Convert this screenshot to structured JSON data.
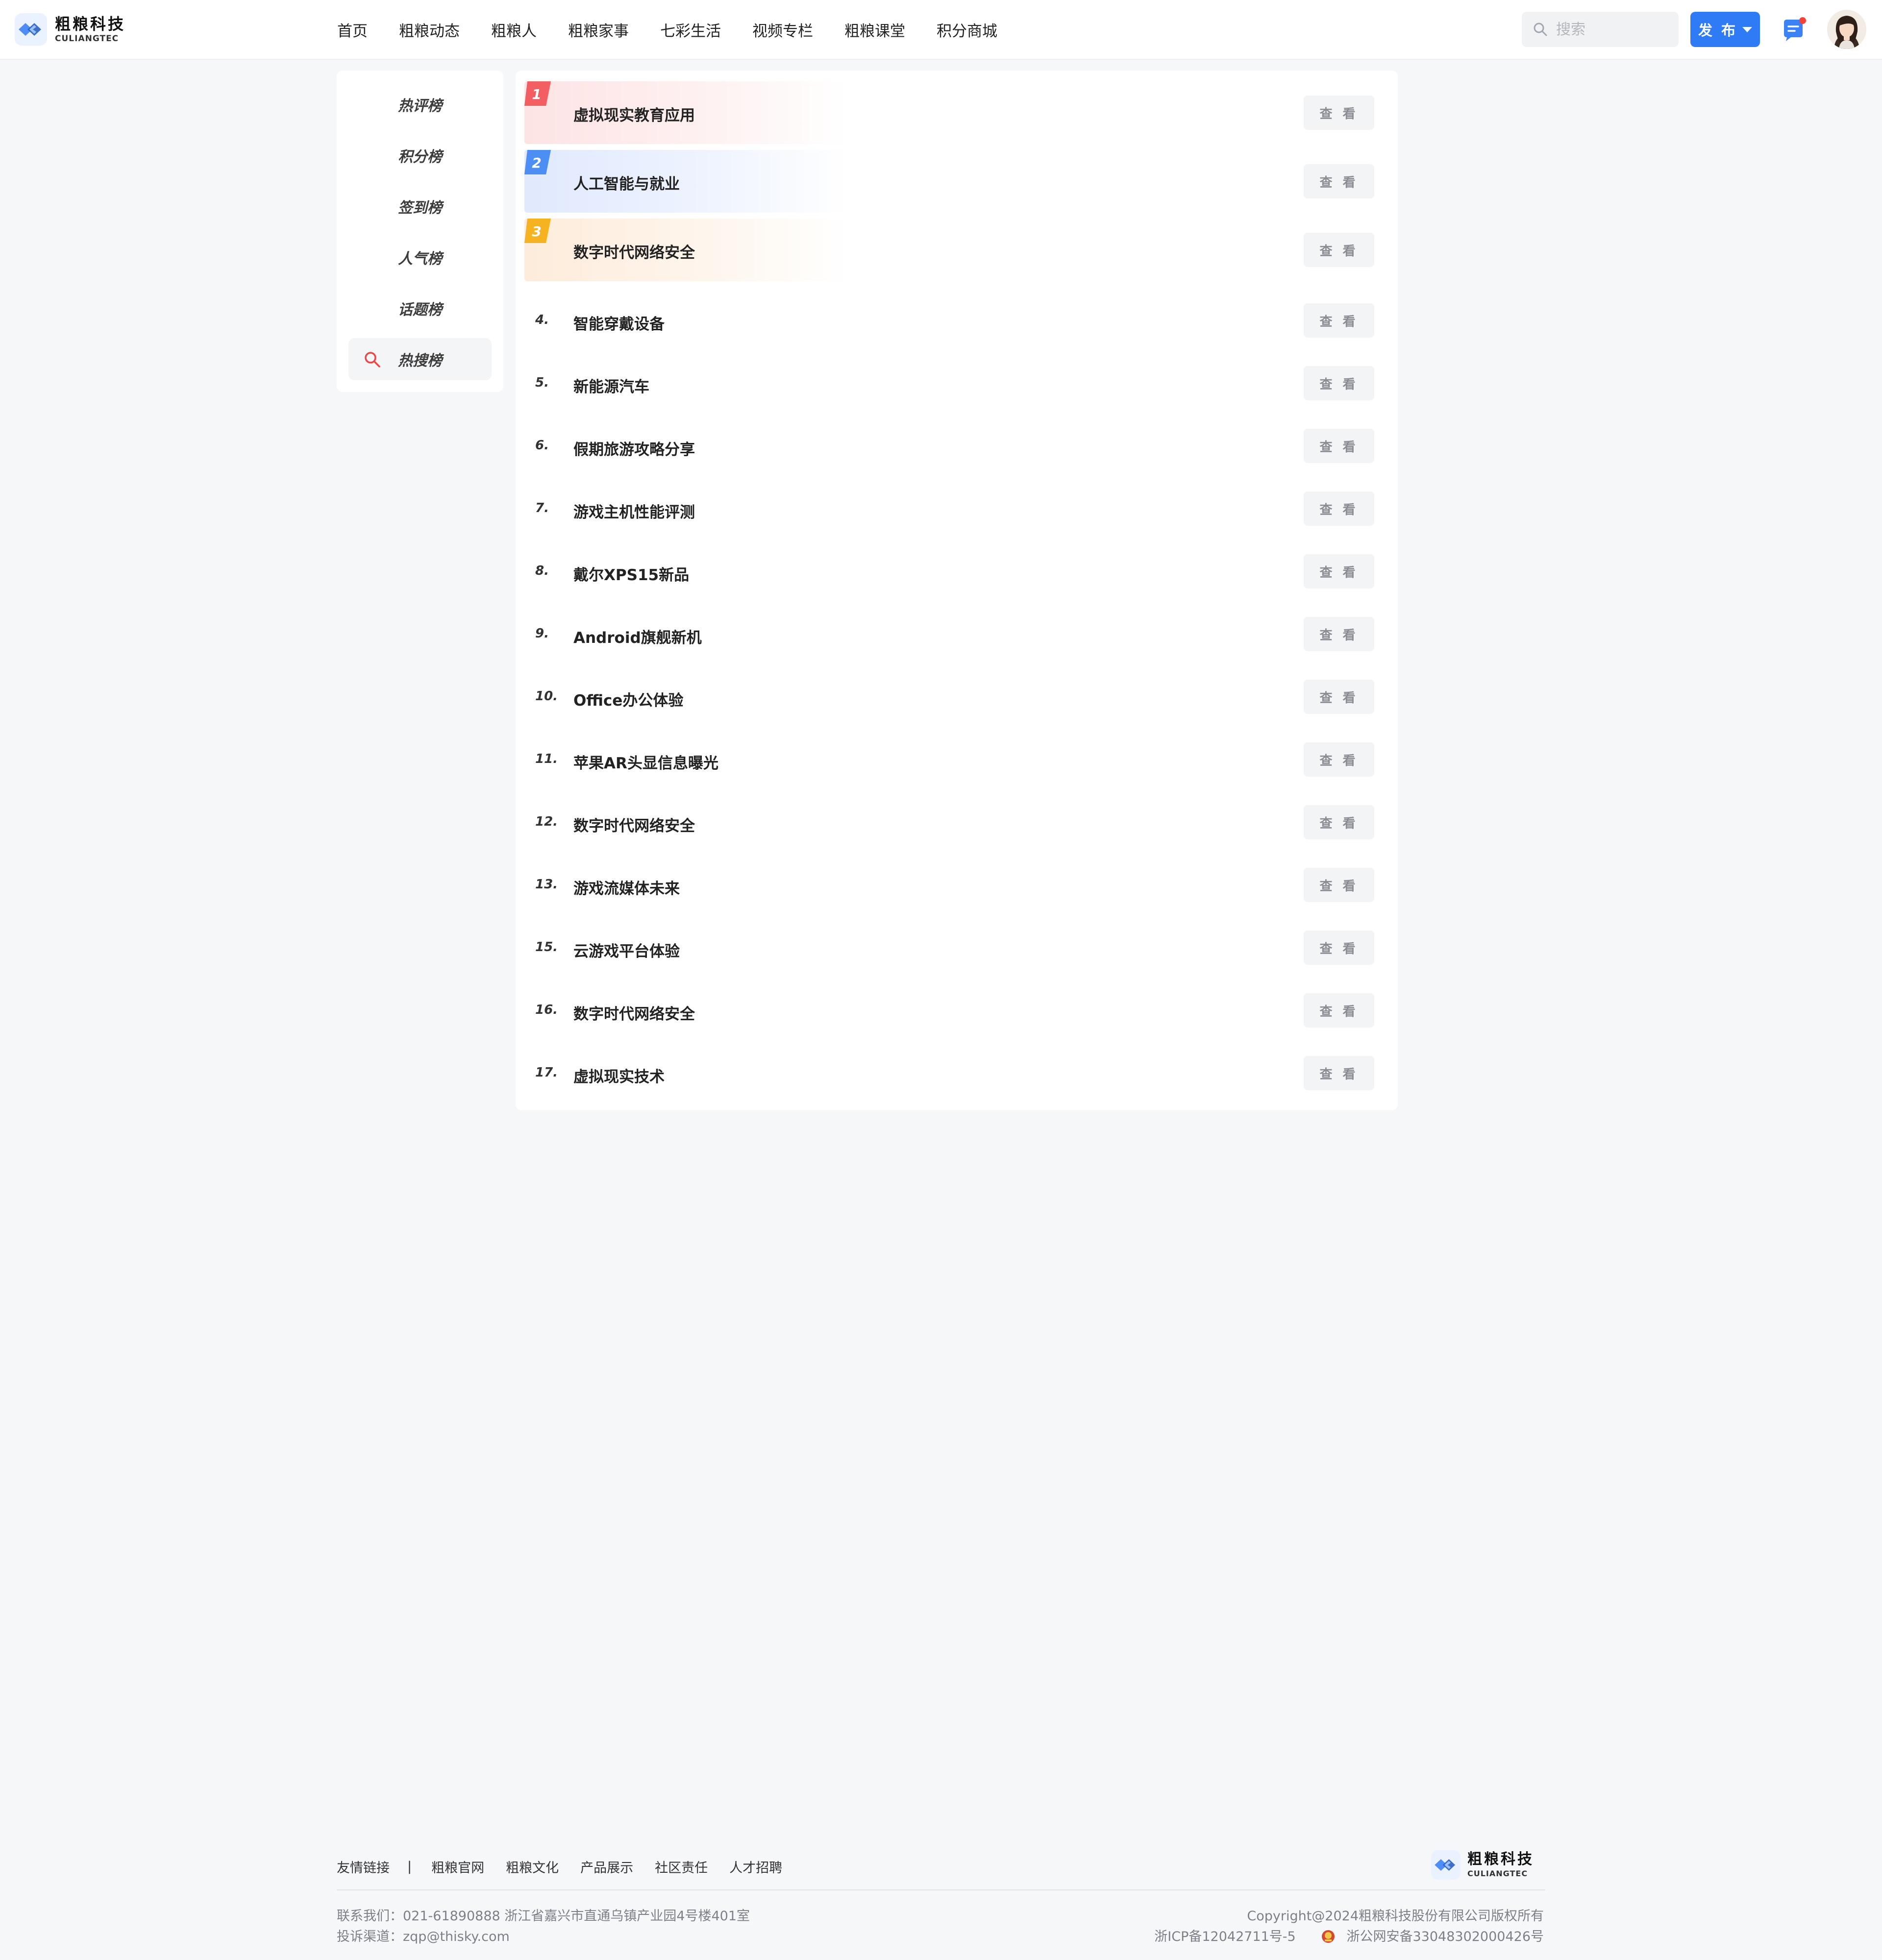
{
  "header": {
    "logo": {
      "cn": "粗粮科技",
      "en": "CULIANGTEC"
    },
    "nav": [
      "首页",
      "粗粮动态",
      "粗粮人",
      "粗粮家事",
      "七彩生活",
      "视频专栏",
      "粗粮课堂",
      "积分商城"
    ],
    "search": {
      "placeholder": "搜索",
      "icon": "search-icon"
    },
    "publish_label": "发 布",
    "message_icon": "chat-bubble-icon",
    "has_unread": true
  },
  "sidebar": {
    "items": [
      {
        "label": "热评榜",
        "active": false
      },
      {
        "label": "积分榜",
        "active": false
      },
      {
        "label": "签到榜",
        "active": false
      },
      {
        "label": "人气榜",
        "active": false
      },
      {
        "label": "话题榜",
        "active": false
      },
      {
        "label": "热搜榜",
        "active": true,
        "icon": "search-icon"
      }
    ]
  },
  "ranking": {
    "view_label": "查 看",
    "top_colors": [
      "#f25e62",
      "#4d8ef5",
      "#f6b321"
    ],
    "items": [
      {
        "rank": "1",
        "title": "虚拟现实教育应用"
      },
      {
        "rank": "2",
        "title": "人工智能与就业"
      },
      {
        "rank": "3",
        "title": "数字时代网络安全"
      },
      {
        "rank": "4.",
        "title": "智能穿戴设备"
      },
      {
        "rank": "5.",
        "title": "新能源汽车"
      },
      {
        "rank": "6.",
        "title": "假期旅游攻略分享"
      },
      {
        "rank": "7.",
        "title": "游戏主机性能评测"
      },
      {
        "rank": "8.",
        "title": "戴尔XPS15新品"
      },
      {
        "rank": "9.",
        "title": "Android旗舰新机"
      },
      {
        "rank": "10.",
        "title": "Office办公体验"
      },
      {
        "rank": "11.",
        "title": "苹果AR头显信息曝光"
      },
      {
        "rank": "12.",
        "title": "数字时代网络安全"
      },
      {
        "rank": "13.",
        "title": "游戏流媒体未来"
      },
      {
        "rank": "15.",
        "title": "云游戏平台体验"
      },
      {
        "rank": "16.",
        "title": "数字时代网络安全"
      },
      {
        "rank": "17.",
        "title": "虚拟现实技术"
      }
    ]
  },
  "footer": {
    "links_label": "友情链接",
    "separator": "|",
    "links": [
      "粗粮官网",
      "粗粮文化",
      "产品展示",
      "社区责任",
      "人才招聘"
    ],
    "logo": {
      "cn": "粗粮科技",
      "en": "CULIANGTEC"
    },
    "contact": "联系我们：021-61890888   浙江省嘉兴市直通乌镇产业园4号楼401室",
    "complaint": "投诉渠道：zqp@thisky.com",
    "copyright": "Copyright@2024粗粮科技股份有限公司版权所有",
    "icp": "浙ICP备12042711号-5",
    "police": "浙公网安备33048302000426号"
  }
}
